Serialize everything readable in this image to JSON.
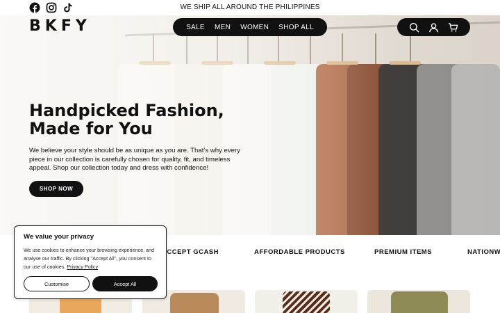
{
  "topbar": {
    "announcement": "WE SHIP ALL AROUND THE PHILIPPINES",
    "socials": [
      "facebook-icon",
      "instagram-icon",
      "tiktok-icon"
    ]
  },
  "header": {
    "logo_text": "BKFY",
    "nav": [
      "SALE",
      "MEN",
      "WOMEN",
      "SHOP ALL"
    ],
    "icons": [
      "search-icon",
      "account-icon",
      "cart-icon"
    ]
  },
  "hero": {
    "title_line1": "Handpicked Fashion,",
    "title_line2": "Made for You",
    "description": "We believe your style should be as unique as you are. That’s why every piece in our collection is carefully chosen for quality, fit, and timeless appeal. Shop our collection today and dress with confidence!",
    "cta": "SHOP NOW"
  },
  "features": [
    "ACCEPT GCASH",
    "AFFORDABLE PRODUCTS",
    "PREMIUM ITEMS",
    "NATIONWI"
  ],
  "cookie": {
    "title": "We value your privacy",
    "text": "We use cookies to enhance your browsing experience, and analyse our traffic. By clicking \"Accept All\", you consent to our use of cookies.",
    "link": "Privacy Policy",
    "customise": "Customise",
    "accept": "Accept All"
  },
  "colors": {
    "primary": "#111111",
    "background": "#ffffff"
  }
}
